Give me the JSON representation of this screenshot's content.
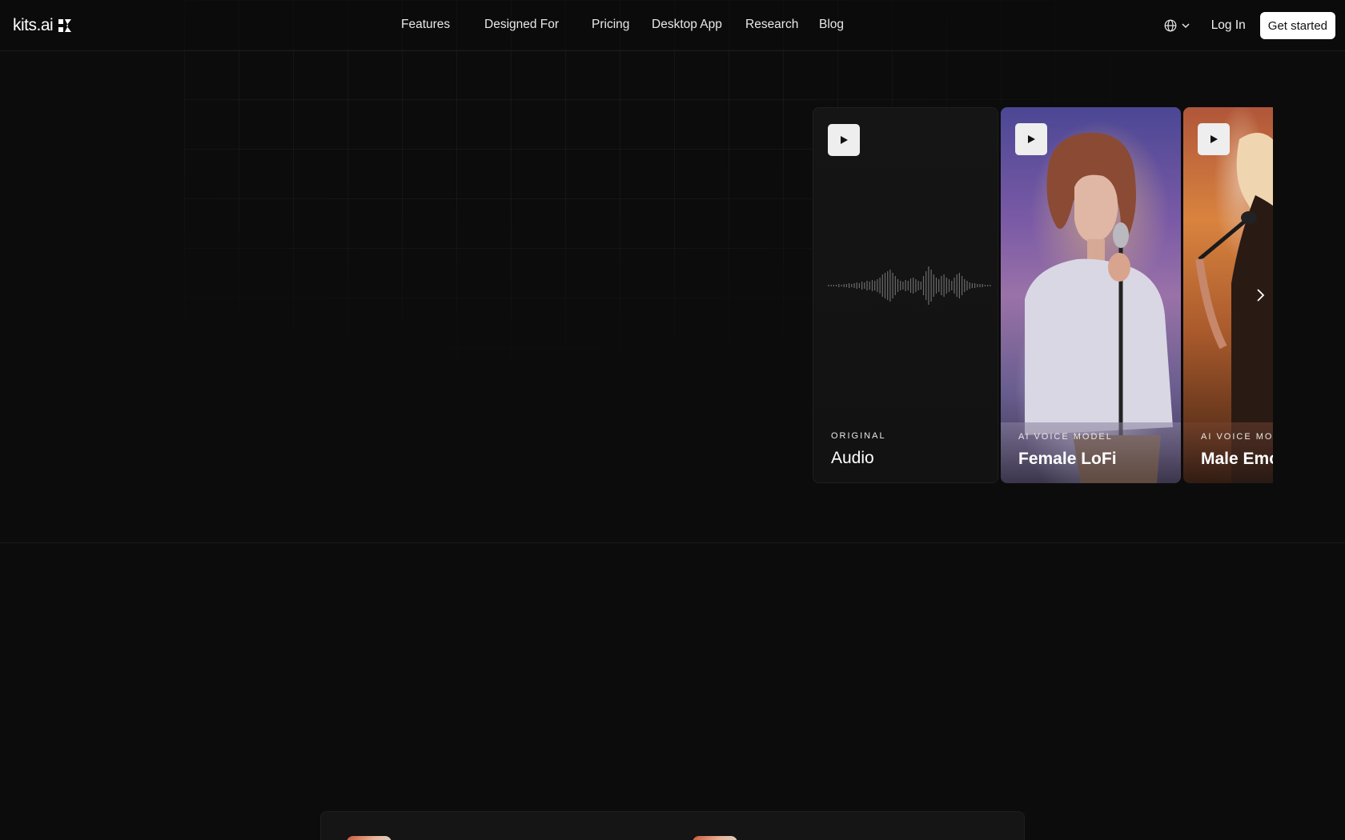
{
  "header": {
    "logo_text": "kits.ai",
    "nav": [
      {
        "label": "Features"
      },
      {
        "label": "Designed For"
      },
      {
        "label": "Pricing"
      },
      {
        "label": "Desktop App"
      },
      {
        "label": "Research"
      },
      {
        "label": "Blog"
      }
    ],
    "language_icon": "globe-icon",
    "login_label": "Log In",
    "cta_label": "Get started"
  },
  "carousel": {
    "cards": [
      {
        "eyebrow": "ORIGINAL",
        "title": "Audio",
        "icon": "play-icon"
      },
      {
        "eyebrow": "AI VOICE MODEL",
        "title": "Female LoFi",
        "icon": "play-icon"
      },
      {
        "eyebrow": "AI VOICE MODEL",
        "title": "Male Emo",
        "icon": "play-icon"
      }
    ],
    "next_icon": "chevron-right-icon"
  },
  "colors": {
    "background": "#0c0c0c",
    "cta_bg": "#ffffff",
    "text": "#f2f2f2"
  }
}
